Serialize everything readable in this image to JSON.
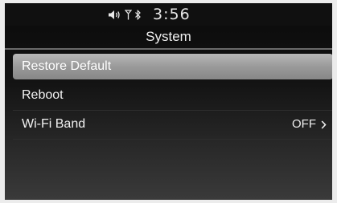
{
  "status": {
    "time": "3:56",
    "icons": [
      "volume-icon",
      "signal-icon",
      "bluetooth-icon"
    ]
  },
  "header": {
    "title": "System"
  },
  "menu": {
    "items": [
      {
        "label": "Restore Default",
        "selected": true
      },
      {
        "label": "Reboot",
        "selected": false
      },
      {
        "label": "Wi-Fi Band",
        "value": "OFF",
        "selected": false
      }
    ]
  },
  "colors": {
    "highlight": "#a0a0a0",
    "background": "#101010",
    "text": "#f0f0f0"
  }
}
